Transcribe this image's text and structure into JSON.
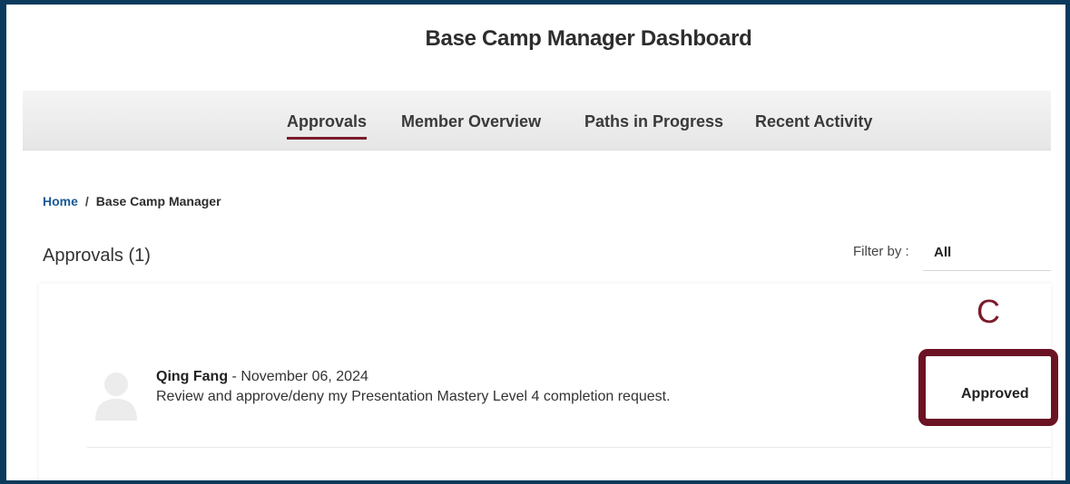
{
  "header": {
    "title": "Base Camp Manager Dashboard"
  },
  "nav": {
    "tabs": [
      {
        "label": "Approvals",
        "active": true
      },
      {
        "label": "Member Overview",
        "active": false
      },
      {
        "label": "Paths in Progress",
        "active": false
      },
      {
        "label": "Recent Activity",
        "active": false
      }
    ]
  },
  "breadcrumb": {
    "home": "Home",
    "separator": "/",
    "current": "Base Camp Manager"
  },
  "approvals": {
    "title": "Approvals (1)",
    "filter_label": "Filter by :",
    "filter_value": "All",
    "items": [
      {
        "name": "Qing Fang",
        "date_sep": " - ",
        "date": "November 06, 2024",
        "message": "Review and approve/deny my Presentation Mastery Level 4 completion request.",
        "status": "Approved",
        "avatar_icon": "user-silhouette-icon"
      }
    ]
  },
  "annotation": {
    "letter": "C",
    "color": "#6b1224"
  },
  "colors": {
    "accent": "#7b1b2b",
    "link": "#1a5a96",
    "frame_border": "#0b3a5c"
  }
}
